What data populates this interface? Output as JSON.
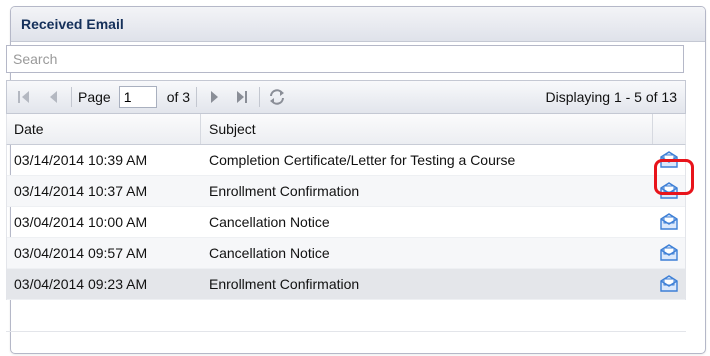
{
  "panel": {
    "title": "Received Email"
  },
  "search": {
    "placeholder": "Search",
    "value": ""
  },
  "pager": {
    "page_label": "Page",
    "current_page": "1",
    "of_label": "of 3",
    "display_info": "Displaying 1 - 5 of 13"
  },
  "columns": {
    "date": "Date",
    "subject": "Subject"
  },
  "rows": [
    {
      "date": "03/14/2014 10:39 AM",
      "subject": "Completion Certificate/Letter for Testing a Course"
    },
    {
      "date": "03/14/2014 10:37 AM",
      "subject": "Enrollment Confirmation"
    },
    {
      "date": "03/04/2014 10:00 AM",
      "subject": "Cancellation Notice"
    },
    {
      "date": "03/04/2014 09:57 AM",
      "subject": "Cancellation Notice"
    },
    {
      "date": "03/04/2014 09:23 AM",
      "subject": "Enrollment Confirmation"
    }
  ],
  "icons": {
    "first": "first-page-icon",
    "prev": "prev-page-icon",
    "next": "next-page-icon",
    "last": "last-page-icon",
    "refresh": "refresh-icon",
    "view": "envelope-icon"
  },
  "colors": {
    "highlight": "#e8141b",
    "header_text": "#15305a",
    "envelope": "#3d7fd6"
  }
}
